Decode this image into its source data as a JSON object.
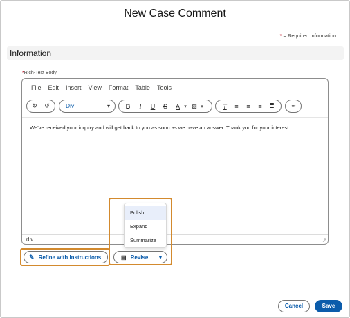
{
  "modal": {
    "title": "New Case Comment"
  },
  "required_note": {
    "star": "*",
    "text": " = Required Information"
  },
  "section": {
    "title": "Information"
  },
  "field": {
    "star": "*",
    "label": "Rich-Text Body"
  },
  "editor": {
    "menu": [
      "File",
      "Edit",
      "Insert",
      "View",
      "Format",
      "Table",
      "Tools"
    ],
    "block_format": "Div",
    "body_text": "We've received your inquiry and will get back to you as soon as we have an answer. Thank you for your interest.",
    "status_path": "div"
  },
  "revise_menu": {
    "items": [
      "Polish",
      "Expand",
      "Summarize"
    ],
    "highlighted": "Polish"
  },
  "actions": {
    "refine_label": "Refine with Instructions",
    "revise_label": "Revise"
  },
  "footer": {
    "cancel_label": "Cancel",
    "save_label": "Save"
  },
  "colors": {
    "brand": "#0b5cab",
    "highlight_outline": "#d38a2e",
    "required": "#ba0517"
  }
}
